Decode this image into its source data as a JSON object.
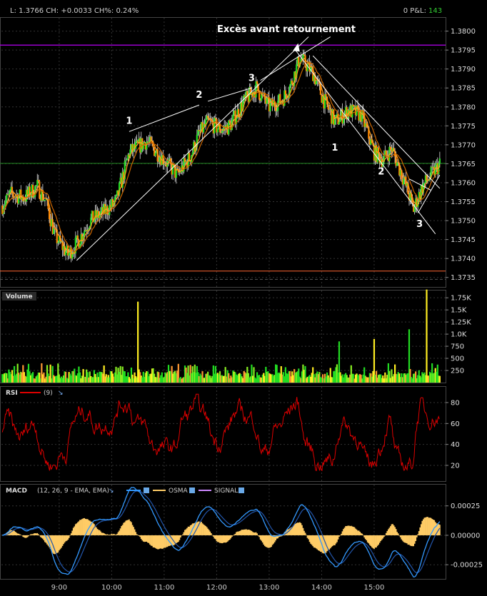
{
  "header": {
    "stats": "L: 1.3766 CH: +0.0033 CH%: 0.24%",
    "pl_label": "0 P&L:",
    "pl_value": "143"
  },
  "colors": {
    "background": "#000000",
    "grid": "#333333",
    "price_up": "#22dd22",
    "price_down": "#ff8800",
    "ma_fast": "#ffa020",
    "ma_slow": "#cc6600",
    "trendline": "#ffffff",
    "resistance_line": "#9900cc",
    "last_price_line": "#228822",
    "support_line": "#ff6633",
    "rsi": "#dd0000",
    "macd": "#3399ff",
    "osma": "#ffcc66",
    "signal": "#cc88ff",
    "pl_value": "#33cc33"
  },
  "chart_data": [
    {
      "type": "candlestick",
      "panel": "price",
      "annotation": "Excès avant retournement",
      "wave_labels": [
        "1",
        "2",
        "3",
        "1",
        "2",
        "3"
      ],
      "y_ticks": [
        1.38,
        1.3795,
        1.379,
        1.3785,
        1.378,
        1.3775,
        1.377,
        1.3765,
        1.376,
        1.3755,
        1.375,
        1.3745,
        1.374,
        1.3735
      ],
      "y_tick_labels": [
        "1.3800",
        "1.3795",
        "1.3790",
        "1.3785",
        "1.3780",
        "1.3775",
        "1.3770",
        "1.3765",
        "1.3760",
        "1.3755",
        "1.3750",
        "1.3745",
        "1.3740",
        "1.3735"
      ],
      "ylim": [
        1.37325,
        1.38035
      ],
      "resistance": 1.37963,
      "last_price": 1.37651,
      "support": 1.37367,
      "x_ticks": [
        "9:00",
        "10:00",
        "11:00",
        "12:00",
        "13:00",
        "14:00",
        "15:00"
      ],
      "price_path": [
        [
          "7:55",
          1.3754
        ],
        [
          "8:05",
          1.3757
        ],
        [
          "8:20",
          1.3756
        ],
        [
          "8:35",
          1.3759
        ],
        [
          "8:45",
          1.3755
        ],
        [
          "8:55",
          1.3746
        ],
        [
          "9:10",
          1.3741
        ],
        [
          "9:20",
          1.3744
        ],
        [
          "9:35",
          1.375
        ],
        [
          "9:50",
          1.3752
        ],
        [
          "10:05",
          1.3755
        ],
        [
          "10:20",
          1.3768
        ],
        [
          "10:40",
          1.3771
        ],
        [
          "11:00",
          1.3766
        ],
        [
          "11:15",
          1.3762
        ],
        [
          "11:30",
          1.3767
        ],
        [
          "11:40",
          1.3773
        ],
        [
          "11:50",
          1.3776
        ],
        [
          "12:05",
          1.3774
        ],
        [
          "12:15",
          1.3775
        ],
        [
          "12:30",
          1.3781
        ],
        [
          "12:45",
          1.3785
        ],
        [
          "13:00",
          1.378
        ],
        [
          "13:15",
          1.3782
        ],
        [
          "13:25",
          1.3786
        ],
        [
          "13:35",
          1.3793
        ],
        [
          "13:50",
          1.3789
        ],
        [
          "14:00",
          1.3783
        ],
        [
          "14:15",
          1.3776
        ],
        [
          "14:30",
          1.3779
        ],
        [
          "14:45",
          1.3778
        ],
        [
          "15:00",
          1.3768
        ],
        [
          "15:10",
          1.3766
        ],
        [
          "15:20",
          1.3769
        ],
        [
          "15:35",
          1.376
        ],
        [
          "15:45",
          1.3753
        ],
        [
          "15:55",
          1.3759
        ],
        [
          "16:05",
          1.3762
        ],
        [
          "16:15",
          1.3765
        ]
      ]
    },
    {
      "type": "bar",
      "panel": "volume",
      "title": "Volume",
      "y_ticks": [
        250,
        500,
        750,
        1000,
        1250,
        1500,
        1750
      ],
      "y_tick_labels": [
        "250",
        "500",
        "750",
        "1.0K",
        "1.25K",
        "1.5K",
        "1.75K"
      ],
      "ylim": [
        0,
        1900
      ],
      "spikes": [
        [
          "10:30",
          1670
        ],
        [
          "14:20",
          850
        ],
        [
          "15:00",
          900
        ],
        [
          "15:40",
          1100
        ],
        [
          "16:00",
          1920
        ]
      ],
      "typical_range": [
        80,
        400
      ]
    },
    {
      "type": "line",
      "panel": "rsi",
      "title": "RSI",
      "params": "(9)",
      "y_ticks": [
        20,
        40,
        60,
        80
      ],
      "y_tick_labels": [
        "20",
        "40",
        "60",
        "80"
      ],
      "ylim": [
        5,
        95
      ]
    },
    {
      "type": "line",
      "panel": "macd",
      "title": "MACD",
      "params": "(12, 26, 9 - EMA, EMA)",
      "legend": [
        "OSMA",
        "SIGNAL"
      ],
      "y_ticks": [
        0.00025,
        0,
        -0.00025
      ],
      "y_tick_labels": [
        "0.00025",
        "0.00000",
        "-0.00025"
      ],
      "ylim": [
        -0.00037,
        0.00043
      ]
    }
  ]
}
